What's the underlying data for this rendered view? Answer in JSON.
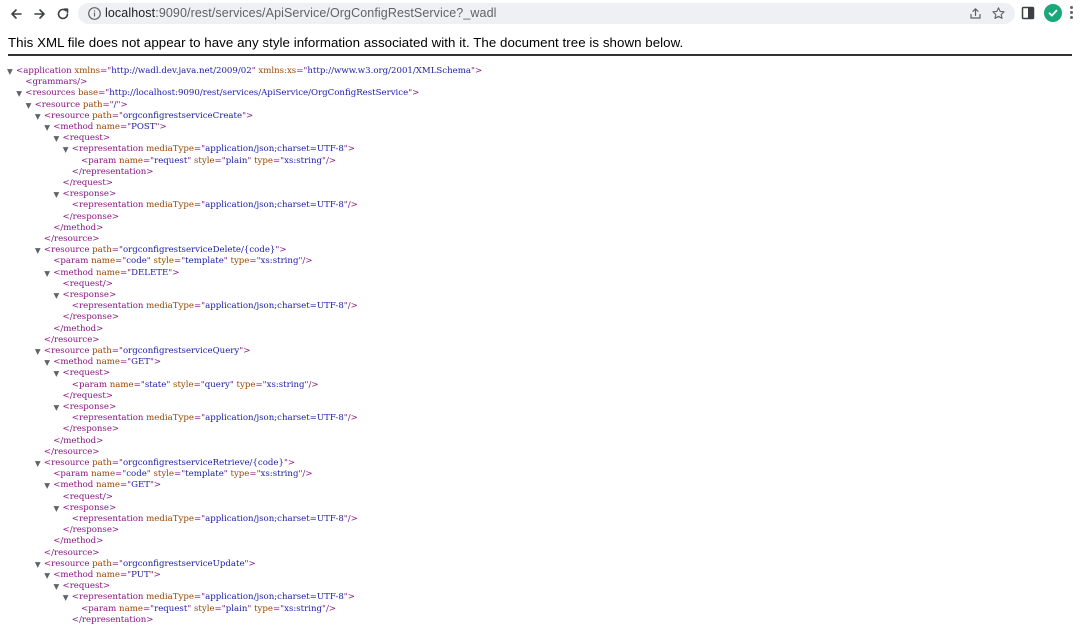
{
  "browser": {
    "url_host": "localhost",
    "url_rest": ":9090/rest/services/ApiService/OrgConfigRestService?_wadl",
    "icons": [
      "back-icon",
      "forward-icon",
      "reload-icon",
      "info-icon",
      "share-icon",
      "star-icon",
      "side-panel-icon",
      "extension-icon",
      "menu-icon"
    ]
  },
  "viewer": {
    "info_text": "This XML file does not appear to have any style information associated with it. The document tree is shown below."
  },
  "colors": {
    "tag": "#881280",
    "attr_name": "#994500",
    "attr_value": "#1a1aa6"
  },
  "tree_lines": [
    {
      "depth": 0,
      "toggle": true,
      "segs": [
        [
          "t",
          "<application "
        ],
        [
          "n",
          "xmlns"
        ],
        [
          "t",
          "=\""
        ],
        [
          "v",
          "http://wadl.dev.java.net/2009/02"
        ],
        [
          "t",
          "\" "
        ],
        [
          "n",
          "xmlns:xs"
        ],
        [
          "t",
          "=\""
        ],
        [
          "v",
          "http://www.w3.org/2001/XMLSchema"
        ],
        [
          "t",
          "\">"
        ]
      ]
    },
    {
      "depth": 1,
      "toggle": false,
      "segs": [
        [
          "t",
          "<grammars/>"
        ]
      ]
    },
    {
      "depth": 1,
      "toggle": true,
      "segs": [
        [
          "t",
          "<resources "
        ],
        [
          "n",
          "base"
        ],
        [
          "t",
          "=\""
        ],
        [
          "v",
          "http://localhost:9090/rest/services/ApiService/OrgConfigRestService"
        ],
        [
          "t",
          "\">"
        ]
      ]
    },
    {
      "depth": 2,
      "toggle": true,
      "segs": [
        [
          "t",
          "<resource "
        ],
        [
          "n",
          "path"
        ],
        [
          "t",
          "=\""
        ],
        [
          "v",
          "/"
        ],
        [
          "t",
          "\">"
        ]
      ]
    },
    {
      "depth": 3,
      "toggle": true,
      "segs": [
        [
          "t",
          "<resource "
        ],
        [
          "n",
          "path"
        ],
        [
          "t",
          "=\""
        ],
        [
          "v",
          "orgconfigrestserviceCreate"
        ],
        [
          "t",
          "\">"
        ]
      ]
    },
    {
      "depth": 4,
      "toggle": true,
      "segs": [
        [
          "t",
          "<method "
        ],
        [
          "n",
          "name"
        ],
        [
          "t",
          "=\""
        ],
        [
          "v",
          "POST"
        ],
        [
          "t",
          "\">"
        ]
      ]
    },
    {
      "depth": 5,
      "toggle": true,
      "segs": [
        [
          "t",
          "<request>"
        ]
      ]
    },
    {
      "depth": 6,
      "toggle": true,
      "segs": [
        [
          "t",
          "<representation "
        ],
        [
          "n",
          "mediaType"
        ],
        [
          "t",
          "=\""
        ],
        [
          "v",
          "application/json;charset=UTF-8"
        ],
        [
          "t",
          "\">"
        ]
      ]
    },
    {
      "depth": 7,
      "toggle": false,
      "segs": [
        [
          "t",
          "<param "
        ],
        [
          "n",
          "name"
        ],
        [
          "t",
          "=\""
        ],
        [
          "v",
          "request"
        ],
        [
          "t",
          "\" "
        ],
        [
          "n",
          "style"
        ],
        [
          "t",
          "=\""
        ],
        [
          "v",
          "plain"
        ],
        [
          "t",
          "\" "
        ],
        [
          "n",
          "type"
        ],
        [
          "t",
          "=\""
        ],
        [
          "v",
          "xs:string"
        ],
        [
          "t",
          "\"/>"
        ]
      ]
    },
    {
      "depth": 6,
      "toggle": false,
      "segs": [
        [
          "t",
          "</representation>"
        ]
      ]
    },
    {
      "depth": 5,
      "toggle": false,
      "segs": [
        [
          "t",
          "</request>"
        ]
      ]
    },
    {
      "depth": 5,
      "toggle": true,
      "segs": [
        [
          "t",
          "<response>"
        ]
      ]
    },
    {
      "depth": 6,
      "toggle": false,
      "segs": [
        [
          "t",
          "<representation "
        ],
        [
          "n",
          "mediaType"
        ],
        [
          "t",
          "=\""
        ],
        [
          "v",
          "application/json;charset=UTF-8"
        ],
        [
          "t",
          "\"/>"
        ]
      ]
    },
    {
      "depth": 5,
      "toggle": false,
      "segs": [
        [
          "t",
          "</response>"
        ]
      ]
    },
    {
      "depth": 4,
      "toggle": false,
      "segs": [
        [
          "t",
          "</method>"
        ]
      ]
    },
    {
      "depth": 3,
      "toggle": false,
      "segs": [
        [
          "t",
          "</resource>"
        ]
      ]
    },
    {
      "depth": 3,
      "toggle": true,
      "segs": [
        [
          "t",
          "<resource "
        ],
        [
          "n",
          "path"
        ],
        [
          "t",
          "=\""
        ],
        [
          "v",
          "orgconfigrestserviceDelete/{code}"
        ],
        [
          "t",
          "\">"
        ]
      ]
    },
    {
      "depth": 4,
      "toggle": false,
      "segs": [
        [
          "t",
          "<param "
        ],
        [
          "n",
          "name"
        ],
        [
          "t",
          "=\""
        ],
        [
          "v",
          "code"
        ],
        [
          "t",
          "\" "
        ],
        [
          "n",
          "style"
        ],
        [
          "t",
          "=\""
        ],
        [
          "v",
          "template"
        ],
        [
          "t",
          "\" "
        ],
        [
          "n",
          "type"
        ],
        [
          "t",
          "=\""
        ],
        [
          "v",
          "xs:string"
        ],
        [
          "t",
          "\"/>"
        ]
      ]
    },
    {
      "depth": 4,
      "toggle": true,
      "segs": [
        [
          "t",
          "<method "
        ],
        [
          "n",
          "name"
        ],
        [
          "t",
          "=\""
        ],
        [
          "v",
          "DELETE"
        ],
        [
          "t",
          "\">"
        ]
      ]
    },
    {
      "depth": 5,
      "toggle": false,
      "segs": [
        [
          "t",
          "<request/>"
        ]
      ]
    },
    {
      "depth": 5,
      "toggle": true,
      "segs": [
        [
          "t",
          "<response>"
        ]
      ]
    },
    {
      "depth": 6,
      "toggle": false,
      "segs": [
        [
          "t",
          "<representation "
        ],
        [
          "n",
          "mediaType"
        ],
        [
          "t",
          "=\""
        ],
        [
          "v",
          "application/json;charset=UTF-8"
        ],
        [
          "t",
          "\"/>"
        ]
      ]
    },
    {
      "depth": 5,
      "toggle": false,
      "segs": [
        [
          "t",
          "</response>"
        ]
      ]
    },
    {
      "depth": 4,
      "toggle": false,
      "segs": [
        [
          "t",
          "</method>"
        ]
      ]
    },
    {
      "depth": 3,
      "toggle": false,
      "segs": [
        [
          "t",
          "</resource>"
        ]
      ]
    },
    {
      "depth": 3,
      "toggle": true,
      "segs": [
        [
          "t",
          "<resource "
        ],
        [
          "n",
          "path"
        ],
        [
          "t",
          "=\""
        ],
        [
          "v",
          "orgconfigrestserviceQuery"
        ],
        [
          "t",
          "\">"
        ]
      ]
    },
    {
      "depth": 4,
      "toggle": true,
      "segs": [
        [
          "t",
          "<method "
        ],
        [
          "n",
          "name"
        ],
        [
          "t",
          "=\""
        ],
        [
          "v",
          "GET"
        ],
        [
          "t",
          "\">"
        ]
      ]
    },
    {
      "depth": 5,
      "toggle": true,
      "segs": [
        [
          "t",
          "<request>"
        ]
      ]
    },
    {
      "depth": 6,
      "toggle": false,
      "segs": [
        [
          "t",
          "<param "
        ],
        [
          "n",
          "name"
        ],
        [
          "t",
          "=\""
        ],
        [
          "v",
          "state"
        ],
        [
          "t",
          "\" "
        ],
        [
          "n",
          "style"
        ],
        [
          "t",
          "=\""
        ],
        [
          "v",
          "query"
        ],
        [
          "t",
          "\" "
        ],
        [
          "n",
          "type"
        ],
        [
          "t",
          "=\""
        ],
        [
          "v",
          "xs:string"
        ],
        [
          "t",
          "\"/>"
        ]
      ]
    },
    {
      "depth": 5,
      "toggle": false,
      "segs": [
        [
          "t",
          "</request>"
        ]
      ]
    },
    {
      "depth": 5,
      "toggle": true,
      "segs": [
        [
          "t",
          "<response>"
        ]
      ]
    },
    {
      "depth": 6,
      "toggle": false,
      "segs": [
        [
          "t",
          "<representation "
        ],
        [
          "n",
          "mediaType"
        ],
        [
          "t",
          "=\""
        ],
        [
          "v",
          "application/json;charset=UTF-8"
        ],
        [
          "t",
          "\"/>"
        ]
      ]
    },
    {
      "depth": 5,
      "toggle": false,
      "segs": [
        [
          "t",
          "</response>"
        ]
      ]
    },
    {
      "depth": 4,
      "toggle": false,
      "segs": [
        [
          "t",
          "</method>"
        ]
      ]
    },
    {
      "depth": 3,
      "toggle": false,
      "segs": [
        [
          "t",
          "</resource>"
        ]
      ]
    },
    {
      "depth": 3,
      "toggle": true,
      "segs": [
        [
          "t",
          "<resource "
        ],
        [
          "n",
          "path"
        ],
        [
          "t",
          "=\""
        ],
        [
          "v",
          "orgconfigrestserviceRetrieve/{code}"
        ],
        [
          "t",
          "\">"
        ]
      ]
    },
    {
      "depth": 4,
      "toggle": false,
      "segs": [
        [
          "t",
          "<param "
        ],
        [
          "n",
          "name"
        ],
        [
          "t",
          "=\""
        ],
        [
          "v",
          "code"
        ],
        [
          "t",
          "\" "
        ],
        [
          "n",
          "style"
        ],
        [
          "t",
          "=\""
        ],
        [
          "v",
          "template"
        ],
        [
          "t",
          "\" "
        ],
        [
          "n",
          "type"
        ],
        [
          "t",
          "=\""
        ],
        [
          "v",
          "xs:string"
        ],
        [
          "t",
          "\"/>"
        ]
      ]
    },
    {
      "depth": 4,
      "toggle": true,
      "segs": [
        [
          "t",
          "<method "
        ],
        [
          "n",
          "name"
        ],
        [
          "t",
          "=\""
        ],
        [
          "v",
          "GET"
        ],
        [
          "t",
          "\">"
        ]
      ]
    },
    {
      "depth": 5,
      "toggle": false,
      "segs": [
        [
          "t",
          "<request/>"
        ]
      ]
    },
    {
      "depth": 5,
      "toggle": true,
      "segs": [
        [
          "t",
          "<response>"
        ]
      ]
    },
    {
      "depth": 6,
      "toggle": false,
      "segs": [
        [
          "t",
          "<representation "
        ],
        [
          "n",
          "mediaType"
        ],
        [
          "t",
          "=\""
        ],
        [
          "v",
          "application/json;charset=UTF-8"
        ],
        [
          "t",
          "\"/>"
        ]
      ]
    },
    {
      "depth": 5,
      "toggle": false,
      "segs": [
        [
          "t",
          "</response>"
        ]
      ]
    },
    {
      "depth": 4,
      "toggle": false,
      "segs": [
        [
          "t",
          "</method>"
        ]
      ]
    },
    {
      "depth": 3,
      "toggle": false,
      "segs": [
        [
          "t",
          "</resource>"
        ]
      ]
    },
    {
      "depth": 3,
      "toggle": true,
      "segs": [
        [
          "t",
          "<resource "
        ],
        [
          "n",
          "path"
        ],
        [
          "t",
          "=\""
        ],
        [
          "v",
          "orgconfigrestserviceUpdate"
        ],
        [
          "t",
          "\">"
        ]
      ]
    },
    {
      "depth": 4,
      "toggle": true,
      "segs": [
        [
          "t",
          "<method "
        ],
        [
          "n",
          "name"
        ],
        [
          "t",
          "=\""
        ],
        [
          "v",
          "PUT"
        ],
        [
          "t",
          "\">"
        ]
      ]
    },
    {
      "depth": 5,
      "toggle": true,
      "segs": [
        [
          "t",
          "<request>"
        ]
      ]
    },
    {
      "depth": 6,
      "toggle": true,
      "segs": [
        [
          "t",
          "<representation "
        ],
        [
          "n",
          "mediaType"
        ],
        [
          "t",
          "=\""
        ],
        [
          "v",
          "application/json;charset=UTF-8"
        ],
        [
          "t",
          "\">"
        ]
      ]
    },
    {
      "depth": 7,
      "toggle": false,
      "segs": [
        [
          "t",
          "<param "
        ],
        [
          "n",
          "name"
        ],
        [
          "t",
          "=\""
        ],
        [
          "v",
          "request"
        ],
        [
          "t",
          "\" "
        ],
        [
          "n",
          "style"
        ],
        [
          "t",
          "=\""
        ],
        [
          "v",
          "plain"
        ],
        [
          "t",
          "\" "
        ],
        [
          "n",
          "type"
        ],
        [
          "t",
          "=\""
        ],
        [
          "v",
          "xs:string"
        ],
        [
          "t",
          "\"/>"
        ]
      ]
    },
    {
      "depth": 6,
      "toggle": false,
      "segs": [
        [
          "t",
          "</representation>"
        ]
      ]
    }
  ]
}
